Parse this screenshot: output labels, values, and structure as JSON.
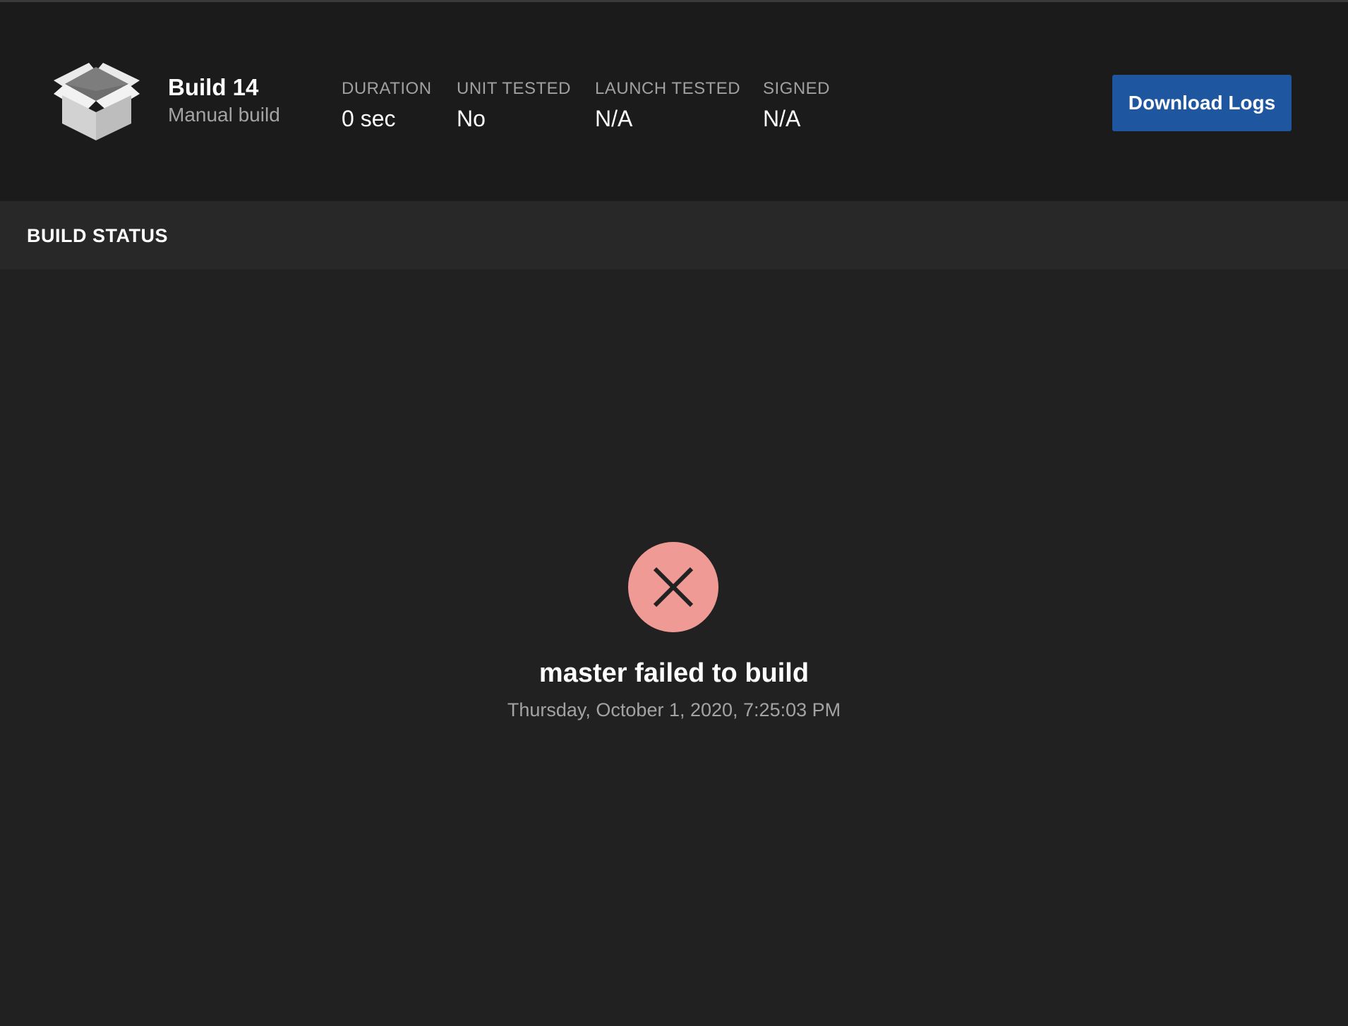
{
  "header": {
    "build_icon": "open-box-icon",
    "title": "Build 14",
    "subtitle": "Manual build",
    "stats": [
      {
        "label": "DURATION",
        "value": "0 sec"
      },
      {
        "label": "UNIT TESTED",
        "value": "No"
      },
      {
        "label": "LAUNCH TESTED",
        "value": "N/A"
      },
      {
        "label": "SIGNED",
        "value": "N/A"
      }
    ],
    "download_label": "Download Logs"
  },
  "section": {
    "title": "BUILD STATUS"
  },
  "status": {
    "icon": "failed-x-icon",
    "message": "master failed to build",
    "timestamp": "Thursday, October 1, 2020, 7:25:03 PM"
  },
  "colors": {
    "header_bg": "#1b1b1c",
    "section_bg": "#282828",
    "content_bg": "#212121",
    "button_bg": "#1e56a0",
    "fail_circle": "#f09a96",
    "fail_x": "#222222"
  }
}
